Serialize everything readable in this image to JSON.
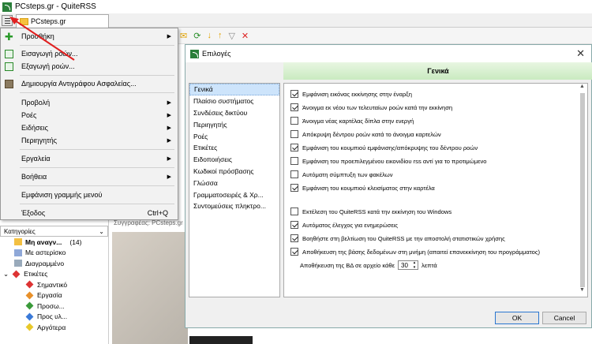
{
  "window": {
    "title": "PCsteps.gr - QuiteRSS"
  },
  "tab": {
    "label": "PCsteps.gr"
  },
  "menu": {
    "items": [
      {
        "label": "Προσθήκη",
        "submenu": true
      },
      {
        "label": "Εισαγωγή ροών..."
      },
      {
        "label": "Εξαγωγή ροών..."
      },
      {
        "label": "Δημιουργία Αντιγράφου Ασφαλείας..."
      },
      {
        "label": "Προβολή",
        "submenu": true
      },
      {
        "label": "Ροές",
        "submenu": true
      },
      {
        "label": "Ειδήσεις",
        "submenu": true
      },
      {
        "label": "Περιηγητής",
        "submenu": true
      },
      {
        "label": "Εργαλεία",
        "submenu": true
      },
      {
        "label": "Βοήθεια",
        "submenu": true
      },
      {
        "label": "Εμφάνιση γραμμής μενού"
      },
      {
        "label": "Έξοδος",
        "shortcut": "Ctrl+Q"
      }
    ]
  },
  "sidebar": {
    "categories_label": "Κατηγορίες",
    "items": [
      {
        "label": "Μη αναγν...",
        "count": "(14)"
      },
      {
        "label": "Με αστερίσκο"
      },
      {
        "label": "Διαγραμμένο"
      },
      {
        "label": "Ετικέτες"
      },
      {
        "label": "Σημαντικό"
      },
      {
        "label": "Εργασία"
      },
      {
        "label": "Προσω..."
      },
      {
        "label": "Προς υλ..."
      },
      {
        "label": "Αργότερα"
      }
    ]
  },
  "content": {
    "header": "Συγγραφέας: PCsteps.gr"
  },
  "dialog": {
    "title": "Επιλογές",
    "header": "Γενικά",
    "nav": [
      "Γενικά",
      "Πλαίσιο συστήματος",
      "Συνδέσεις δικτύου",
      "Περιηγητής",
      "Ροές",
      "Ετικέτες",
      "Ειδοποιήσεις",
      "Κωδικοί πρόσβασης",
      "Γλώσσα",
      "Γραμματοσειρές & Χρ...",
      "Συντομεύσεις πληκτρο..."
    ],
    "options": [
      {
        "label": "Εμφάνιση εικόνας εκκίνησης στην έναρξη",
        "checked": true
      },
      {
        "label": "Άνοιγμα εκ νέου των τελευταίων ροών κατά την εκκίνηση",
        "checked": true
      },
      {
        "label": "Άνοιγμα νέας καρτέλας δίπλα στην ενεργή",
        "checked": false
      },
      {
        "label": "Απόκρυψη δέντρου ροών κατά το άνοιγμα καρτελών",
        "checked": false
      },
      {
        "label": "Εμφάνιση του κουμπιού εμφάνισης/απόκρυψης του δέντρου ροών",
        "checked": true
      },
      {
        "label": "Εμφάνιση του προεπιλεγμένου εικονιδίου rss αντί για το προτιμώμενο",
        "checked": false
      },
      {
        "label": "Αυτόματη σύμπτυξη των φακέλων",
        "checked": false
      },
      {
        "label": "Εμφάνιση του κουμπιού κλεισίματος στην καρτέλα",
        "checked": true
      },
      {
        "label": "Εκτέλεση του QuiteRSS κατά την εκκίνηση του Windows",
        "checked": false
      },
      {
        "label": "Αυτόματος έλεγχος για ενημερώσεις",
        "checked": true
      },
      {
        "label": "Βοηθήστε στη βελτίωση του QuiteRSS με την αποστολή στατιστικών χρήσης",
        "checked": true
      },
      {
        "label": "Αποθήκευση της βάσης δεδομένων στη μνήμη (απαιτεί επανεκκίνηση του προγράμματος)",
        "checked": true
      }
    ],
    "backup_prefix": "Αποθήκευση της ΒΔ σε αρχείο κάθε",
    "backup_value": "30",
    "backup_unit": "λεπτά",
    "ok_label": "OK",
    "cancel_label": "Cancel"
  }
}
